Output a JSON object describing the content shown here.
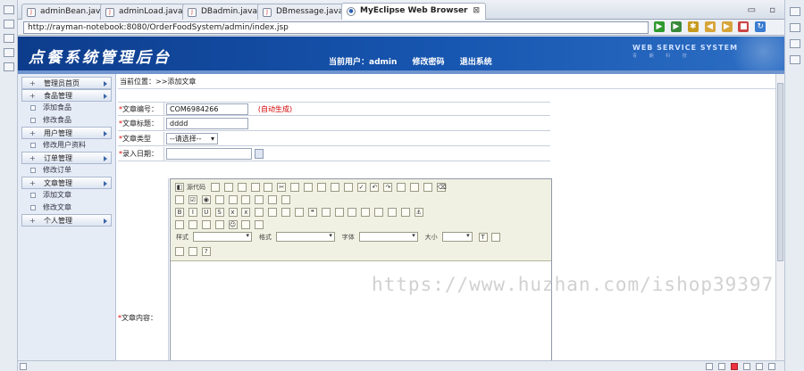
{
  "tabs": [
    {
      "label": "adminBean.java",
      "icon": "java-file-icon",
      "active": false
    },
    {
      "label": "adminLoad.java",
      "icon": "java-file-icon",
      "active": false
    },
    {
      "label": "DBadmin.java",
      "icon": "java-file-icon",
      "active": false
    },
    {
      "label": "DBmessage.java",
      "icon": "java-file-icon",
      "active": false
    },
    {
      "label": "MyEclipse Web Browser",
      "icon": "globe-icon",
      "active": true
    }
  ],
  "tab_close": "⊠",
  "window_controls": "▭ ▫",
  "url": "http://rayman-notebook:8080/OrderFoodSystem/admin/index.jsp",
  "banner": {
    "logo": "点餐系统管理后台",
    "current_user_label": "当前用户：admin",
    "change_password": "修改密码",
    "logout": "退出系统",
    "ws_title": "WEB SERVICE SYSTEM",
    "ws_sub": "青 朗 科 技"
  },
  "sidebar": [
    {
      "label": "管理员首页",
      "type": "cat"
    },
    {
      "label": "食品管理",
      "type": "cat"
    },
    {
      "label": "添加食品",
      "type": "sub"
    },
    {
      "label": "修改食品",
      "type": "sub"
    },
    {
      "label": "用户管理",
      "type": "cat"
    },
    {
      "label": "修改用户资料",
      "type": "sub"
    },
    {
      "label": "订单管理",
      "type": "cat"
    },
    {
      "label": "修改订单",
      "type": "sub"
    },
    {
      "label": "文章管理",
      "type": "cat"
    },
    {
      "label": "添加文章",
      "type": "sub"
    },
    {
      "label": "修改文章",
      "type": "sub"
    },
    {
      "label": "个人管理",
      "type": "cat"
    }
  ],
  "breadcrumb": "当前位置：>>添加文章",
  "form": {
    "article_no_label": "文章编号：",
    "article_no_value": "COM6984266",
    "article_no_note": "(自动生成)",
    "title_label": "文章标题：",
    "title_value": "dddd",
    "type_label": "文章类型",
    "type_value": "--请选择--",
    "date_label": "录入日期：",
    "date_value": "",
    "content_label": "文章内容：",
    "required_mark": "*"
  },
  "editor": {
    "source_label": "源代码",
    "style_label": "样式",
    "format_label": "格式",
    "font_label": "字体",
    "size_label": "大小"
  },
  "watermark": "https://www.huzhan.com/ishop39397"
}
